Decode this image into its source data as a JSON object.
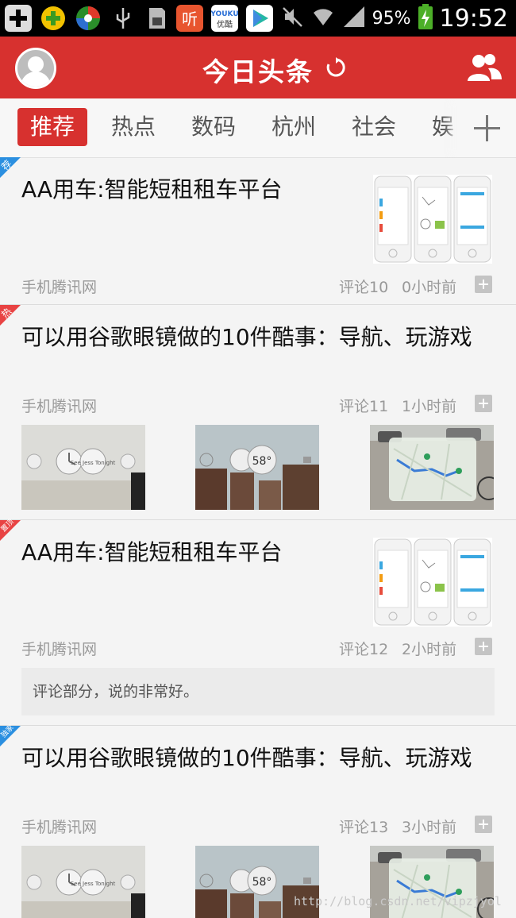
{
  "status_bar": {
    "battery": "95%",
    "time": "19:52",
    "app_icons": [
      "plus-icon",
      "plus-round-icon",
      "swirl-icon",
      "usb-icon",
      "sd-card-icon",
      "listen-app-icon",
      "youku-app-icon",
      "video-app-icon"
    ]
  },
  "header": {
    "title": "今日头条"
  },
  "tabs": [
    "推荐",
    "热点",
    "数码",
    "杭州",
    "社会",
    "娱"
  ],
  "feed": [
    {
      "tag": "荐",
      "tag_color": "#2b8fe0",
      "title": "AA用车:智能短租租车平台",
      "source": "手机腾讯网",
      "comments": "评论10",
      "time": "0小时前"
    },
    {
      "tag": "热",
      "tag_color": "#e84343",
      "title": "可以用谷歌眼镜做的10件酷事：导航、玩游戏",
      "source": "手机腾讯网",
      "comments": "评论11",
      "time": "1小时前"
    },
    {
      "tag": "置顶",
      "tag_color": "#e84343",
      "title": "AA用车:智能短租租车平台",
      "source": "手机腾讯网",
      "comments": "评论12",
      "time": "2小时前",
      "comment_text": "评论部分，说的非常好。"
    },
    {
      "tag": "独家",
      "tag_color": "#2b8fe0",
      "title": "可以用谷歌眼镜做的10件酷事：导航、玩游戏",
      "source": "手机腾讯网",
      "comments": "评论13",
      "time": "3小时前"
    }
  ],
  "thumb_labels": {
    "weather": "58°",
    "tonight": "See Jess Tonight"
  },
  "watermark": "http://blog.csdn.net/vipzjyol",
  "colors": {
    "brand_red": "#d7312f",
    "tag_blue": "#2b8fe0",
    "tag_red": "#e84343"
  }
}
